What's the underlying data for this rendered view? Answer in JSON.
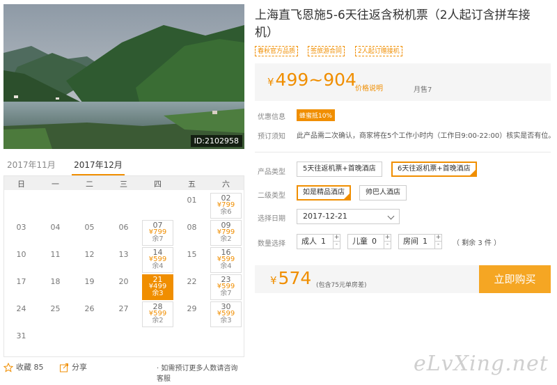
{
  "product": {
    "title": "上海直飞恩施5-6天往返含税机票（2人起订含拼车接机）",
    "image_id": "ID:2102958",
    "tags": [
      "春秋官方品质",
      "签旅游合同",
      "2人起订赠接机"
    ],
    "price_symbol": "¥",
    "price_range": "499~904",
    "price_note": "价格说明",
    "monthly_sales": "月售7"
  },
  "info": {
    "promo_label": "优惠信息",
    "promo_badge": "蜂蜜抵10%",
    "notice_label": "预订须知",
    "notice_text": "此产品需二次确认，商家将在5个工作小时内（工作日9:00-22:00）核实是否有位。"
  },
  "options": {
    "product_type_label": "产品类型",
    "product_types": [
      {
        "label": "5天往返机票+首晚酒店",
        "active": false
      },
      {
        "label": "6天往返机票+首晚酒店",
        "active": true
      }
    ],
    "sub_type_label": "二级类型",
    "sub_types": [
      {
        "label": "如是精品酒店",
        "active": true
      },
      {
        "label": "帅巴人酒店",
        "active": false
      }
    ],
    "date_label": "选择日期",
    "date_value": "2017-12-21",
    "quantity_label": "数量选择",
    "adult_label": "成人",
    "adult_value": "1",
    "child_label": "儿童",
    "child_value": "0",
    "room_label": "房间",
    "room_value": "1",
    "plus": "+",
    "minus": "-",
    "remaining": "（ 剩余 3 件 ）"
  },
  "purchase": {
    "price_symbol": "¥",
    "total": "574",
    "note": "(包含75元单房差)",
    "buy_label": "立即购买"
  },
  "calendar": {
    "months": [
      "2017年11月",
      "2017年12月"
    ],
    "active_month": "2017年12月",
    "weekdays": [
      "日",
      "一",
      "二",
      "三",
      "四",
      "五",
      "六"
    ],
    "days": [
      {
        "day": "01",
        "col": 5,
        "row": 0
      },
      {
        "day": "02",
        "col": 6,
        "row": 0,
        "price": "¥799",
        "remain": "余6"
      },
      {
        "day": "03",
        "col": 0,
        "row": 1
      },
      {
        "day": "04",
        "col": 1,
        "row": 1
      },
      {
        "day": "05",
        "col": 2,
        "row": 1
      },
      {
        "day": "06",
        "col": 3,
        "row": 1
      },
      {
        "day": "07",
        "col": 4,
        "row": 1,
        "price": "¥799",
        "remain": "余7"
      },
      {
        "day": "08",
        "col": 5,
        "row": 1
      },
      {
        "day": "09",
        "col": 6,
        "row": 1,
        "price": "¥799",
        "remain": "余2"
      },
      {
        "day": "10",
        "col": 0,
        "row": 2
      },
      {
        "day": "11",
        "col": 1,
        "row": 2
      },
      {
        "day": "12",
        "col": 2,
        "row": 2
      },
      {
        "day": "13",
        "col": 3,
        "row": 2
      },
      {
        "day": "14",
        "col": 4,
        "row": 2,
        "price": "¥599",
        "remain": "余4"
      },
      {
        "day": "15",
        "col": 5,
        "row": 2
      },
      {
        "day": "16",
        "col": 6,
        "row": 2,
        "price": "¥599",
        "remain": "余4"
      },
      {
        "day": "17",
        "col": 0,
        "row": 3
      },
      {
        "day": "18",
        "col": 1,
        "row": 3
      },
      {
        "day": "19",
        "col": 2,
        "row": 3
      },
      {
        "day": "20",
        "col": 3,
        "row": 3
      },
      {
        "day": "21",
        "col": 4,
        "row": 3,
        "price": "¥499",
        "remain": "余3",
        "selected": true
      },
      {
        "day": "22",
        "col": 5,
        "row": 3
      },
      {
        "day": "23",
        "col": 6,
        "row": 3,
        "price": "¥599",
        "remain": "余7"
      },
      {
        "day": "24",
        "col": 0,
        "row": 4
      },
      {
        "day": "25",
        "col": 1,
        "row": 4
      },
      {
        "day": "26",
        "col": 2,
        "row": 4
      },
      {
        "day": "27",
        "col": 3,
        "row": 4
      },
      {
        "day": "28",
        "col": 4,
        "row": 4,
        "price": "¥599",
        "remain": "余2"
      },
      {
        "day": "29",
        "col": 5,
        "row": 4
      },
      {
        "day": "30",
        "col": 6,
        "row": 4,
        "price": "¥599",
        "remain": "余3"
      },
      {
        "day": "31",
        "col": 0,
        "row": 5
      }
    ]
  },
  "footer": {
    "favorite_label": "收藏",
    "favorite_count": "85",
    "share_label": "分享",
    "consult_text": "· 如需预订更多人数请咨询客服"
  },
  "watermark": "eLvXing.net",
  "colors": {
    "accent": "#f08e00",
    "buy_button": "#f5a623"
  },
  "icons": [
    "star-icon",
    "share-icon",
    "dropdown-arrow-icon"
  ]
}
